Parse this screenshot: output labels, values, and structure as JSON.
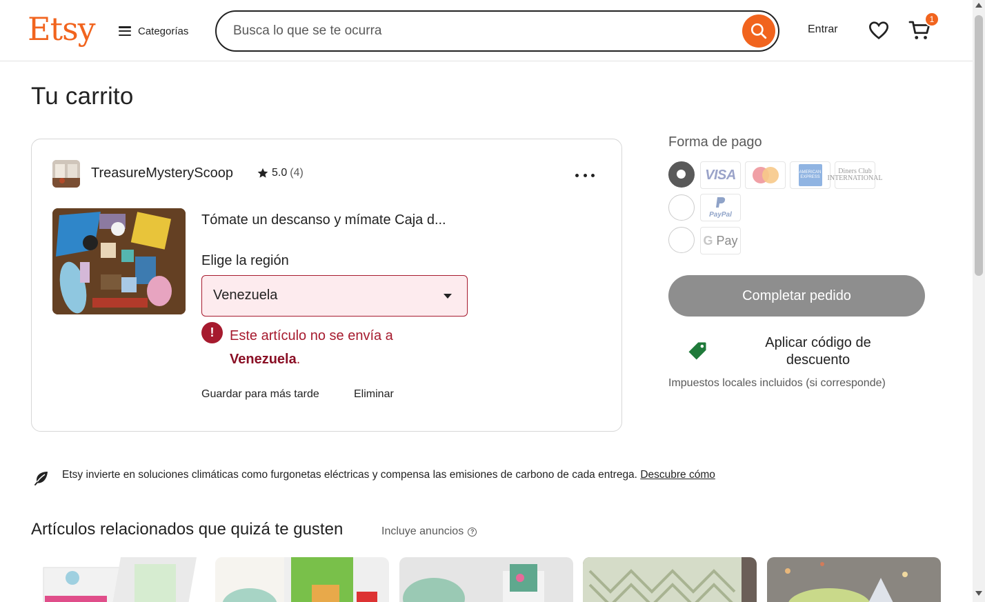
{
  "header": {
    "logo": "Etsy",
    "categories_label": "Categorías",
    "search_placeholder": "Busca lo que se te ocurra",
    "signin_label": "Entrar",
    "cart_count": "1",
    "icons": [
      "menu-icon",
      "search-icon",
      "heart-icon",
      "cart-icon"
    ]
  },
  "page": {
    "title": "Tu carrito"
  },
  "cart_item": {
    "shop_name": "TreasureMysteryScoop",
    "rating": "5.0",
    "review_count": "(4)",
    "product_title": "Tómate un descanso y mímate Caja d...",
    "region_label": "Elige la región",
    "region_value": "Venezuela",
    "error_prefix": "Este artículo no se envía a",
    "error_country": "Venezuela",
    "error_suffix": ".",
    "save_later": "Guardar para más tarde",
    "remove": "Eliminar"
  },
  "payment": {
    "title": "Forma de pago",
    "methods": [
      {
        "name": "Card",
        "selected": true,
        "logos": [
          "VISA",
          "Mastercard",
          "American Express",
          "Diners Club International"
        ]
      },
      {
        "name": "PayPal",
        "selected": false,
        "logos": [
          "PayPal"
        ]
      },
      {
        "name": "Google Pay",
        "selected": false,
        "logos": [
          "G Pay"
        ]
      }
    ],
    "visa_label": "VISA",
    "amex_label": "AMERICAN EXPRESS",
    "diners_label": "Diners Club INTERNATIONAL",
    "paypal_label": "PayPal",
    "gpay_g": "G",
    "gpay_label": "Pay",
    "complete_button": "Completar pedido",
    "coupon_label": "Aplicar código de descuento",
    "taxes_note": "Impuestos locales incluidos (si corresponde)"
  },
  "climate": {
    "text": "Etsy invierte en soluciones climáticas como furgonetas eléctricas y compensa las emisiones de carbono de cada entrega.",
    "link": "Descubre cómo"
  },
  "related": {
    "title": "Artículos relacionados que quizá te gusten",
    "ads_note": "Incluye anuncios",
    "help_glyph": "?"
  },
  "colors": {
    "brand_orange": "#f1641e",
    "error_red": "#a61a2e",
    "disabled_gray": "#8e8e8e",
    "coupon_green": "#1f7a3a"
  }
}
